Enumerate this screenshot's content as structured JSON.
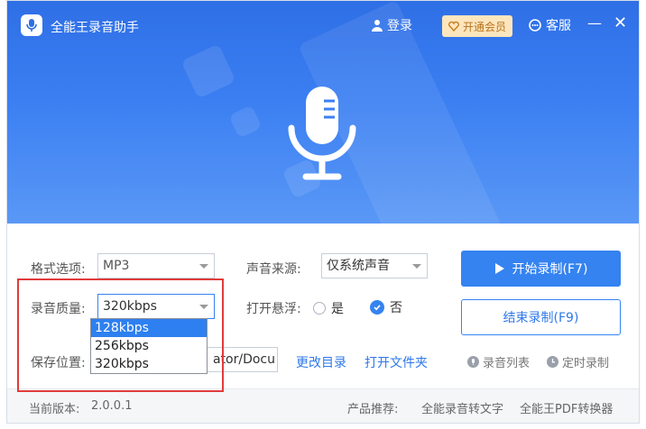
{
  "app": {
    "title": "全能王录音助手"
  },
  "titlebar": {
    "login_label": "登录",
    "vip_label": "开通会员",
    "service_label": "客服",
    "minimize_glyph": "—",
    "close_glyph": "✕"
  },
  "settings": {
    "format_label": "格式选项:",
    "format_value": "MP3",
    "source_label": "声音来源:",
    "source_value": "仅系统声音",
    "quality_label": "录音质量:",
    "quality_value": "320kbps",
    "quality_options": [
      "128kbps",
      "256kbps",
      "320kbps"
    ],
    "float_label": "打开悬浮:",
    "float_yes": "是",
    "float_no": "否",
    "save_label": "保存位置:",
    "save_path_visible": "ator/Docu",
    "change_dir_label": "更改目录",
    "open_folder_label": "打开文件夹"
  },
  "actions": {
    "start_label": "开始录制(F7)",
    "stop_label": "结束录制(F9)",
    "record_list_label": "录音列表",
    "timer_label": "定时录制"
  },
  "footer": {
    "version_label": "当前版本:",
    "version_value": "2.0.0.1",
    "recommend_label": "产品推荐:",
    "product_1": "全能录音转文字",
    "product_2": "全能王PDF转换器"
  },
  "colors": {
    "primary": "#3583f0",
    "hero_top": "#2f6fe6",
    "highlight": "#e13b3b"
  }
}
